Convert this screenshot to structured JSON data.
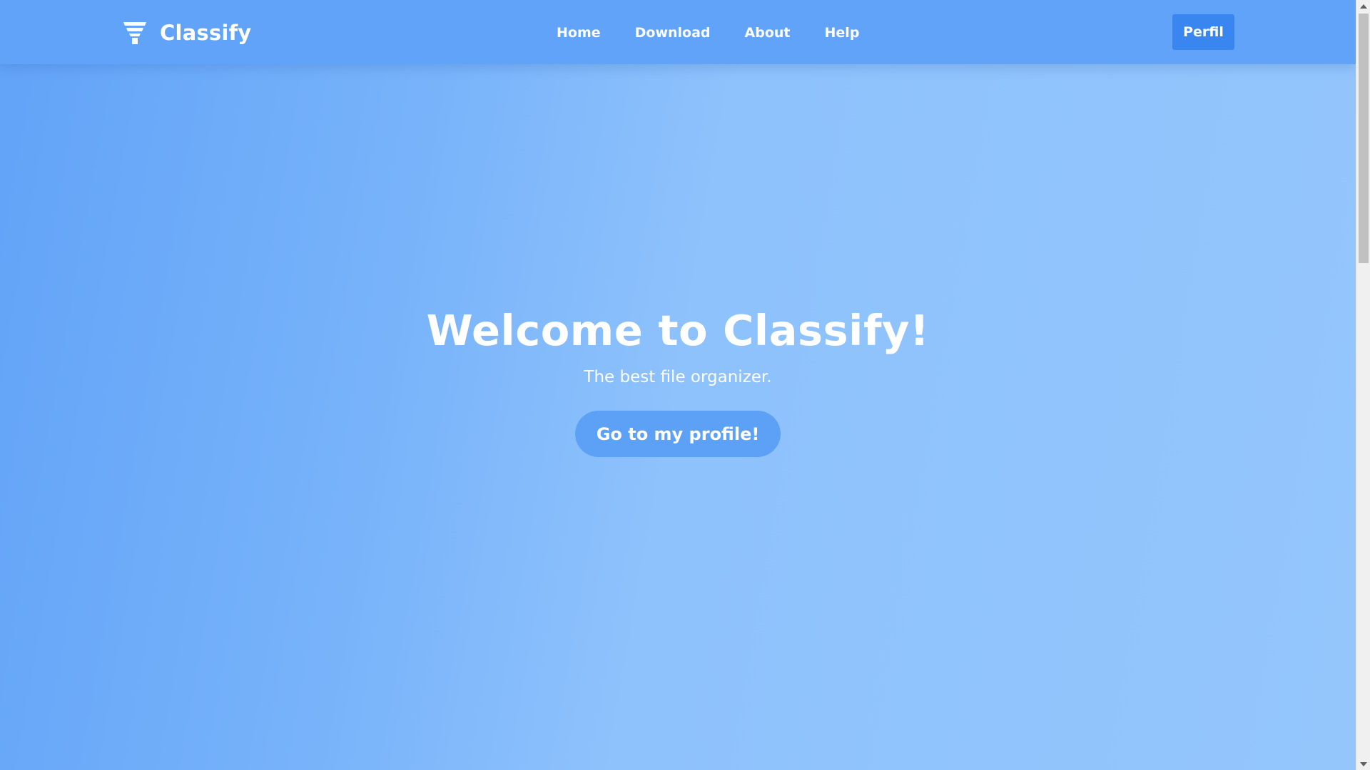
{
  "colors": {
    "navbar": "#60a3f8",
    "accent_button": "#3a86f1",
    "cta_button": "#5da1f7",
    "text": "#ffffff"
  },
  "navbar": {
    "brand": {
      "icon": "funnel-icon",
      "name": "Classify"
    },
    "links": [
      {
        "label": "Home"
      },
      {
        "label": "Download"
      },
      {
        "label": "About"
      },
      {
        "label": "Help"
      }
    ],
    "profile_button": "Perfil"
  },
  "hero": {
    "title": "Welcome to Classify!",
    "subtitle": "The best file organizer.",
    "cta_label": "Go to my profile!"
  },
  "scrollbar": {
    "up_icon": "scroll-up-arrow-icon",
    "down_icon": "scroll-down-arrow-icon"
  }
}
